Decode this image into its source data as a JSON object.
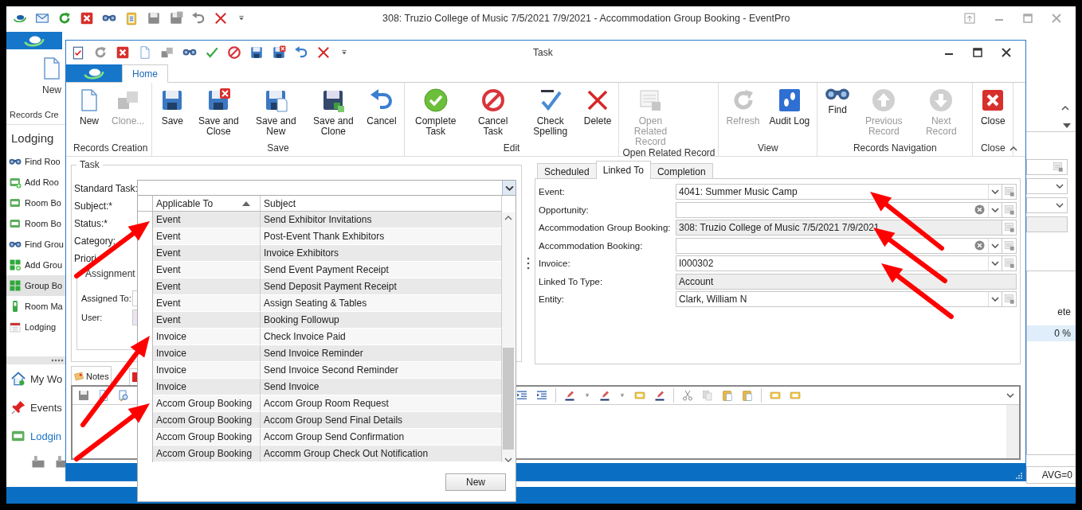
{
  "main_window": {
    "title": "308: Truzio College of Music 7/5/2021 7/9/2021 - Accommodation Group Booking - EventPro",
    "ribbon": {
      "new_button": "New",
      "group_label": "Records Cre"
    },
    "navigation": {
      "heading": "Lodging",
      "items": [
        {
          "label": "Find Roo",
          "selected": false
        },
        {
          "label": "Add Roo",
          "selected": false
        },
        {
          "label": "Room Bo",
          "selected": false
        },
        {
          "label": "Room Bo",
          "selected": false
        },
        {
          "label": "Find Grou",
          "selected": false
        },
        {
          "label": "Add Grou",
          "selected": false
        },
        {
          "label": "Group Bo",
          "selected": true
        },
        {
          "label": "Room Ma",
          "selected": false
        },
        {
          "label": "Lodging",
          "selected": false
        }
      ]
    },
    "nav_bar": [
      {
        "label": "My Wo",
        "selected": false
      },
      {
        "label": "Events",
        "selected": false
      },
      {
        "label": "Lodgin",
        "selected": true
      }
    ],
    "side_content": {
      "column_label": "ete",
      "percent": "0 %",
      "summary": "AVG=0"
    }
  },
  "task_window": {
    "title": "Task",
    "tabs": [
      {
        "label": "Home",
        "selected": true
      }
    ],
    "ribbon_groups": [
      {
        "label": "Records Creation",
        "buttons": [
          {
            "label": "New",
            "disabled": false
          },
          {
            "label": "Clone...",
            "disabled": true
          }
        ]
      },
      {
        "label": "Save",
        "buttons": [
          {
            "label": "Save",
            "disabled": false
          },
          {
            "label": "Save and Close",
            "disabled": false
          },
          {
            "label": "Save and New",
            "disabled": false
          },
          {
            "label": "Save and Clone",
            "disabled": false
          },
          {
            "label": "Cancel",
            "disabled": false
          }
        ]
      },
      {
        "label": "Edit",
        "buttons": [
          {
            "label": "Complete Task",
            "disabled": false
          },
          {
            "label": "Cancel Task",
            "disabled": false
          },
          {
            "label": "Check Spelling",
            "disabled": false
          },
          {
            "label": "Delete",
            "disabled": false
          }
        ]
      },
      {
        "label": "Open Related Record",
        "buttons": [
          {
            "label": "Open Related Record",
            "disabled": true
          }
        ]
      },
      {
        "label": "View",
        "buttons": [
          {
            "label": "Refresh",
            "disabled": true
          },
          {
            "label": "Audit Log",
            "disabled": false
          }
        ]
      },
      {
        "label": "Records Navigation",
        "buttons": [
          {
            "label": "Find",
            "disabled": false
          },
          {
            "label": "Previous Record",
            "disabled": true
          },
          {
            "label": "Next Record",
            "disabled": true
          }
        ]
      },
      {
        "label": "Close",
        "buttons": [
          {
            "label": "Close",
            "disabled": false
          }
        ]
      }
    ],
    "task_form": {
      "legend": "Task",
      "labels": [
        "Standard Task:",
        "Subject:*",
        "Status:*",
        "Category:",
        "Priori"
      ],
      "assignment": {
        "legend": "Assignment",
        "labels": [
          "Assigned To:",
          "User:"
        ]
      }
    },
    "notes_tabs": [
      {
        "label": "Notes",
        "selected": true
      }
    ],
    "linked_tabs": [
      {
        "label": "Scheduled",
        "selected": false
      },
      {
        "label": "Linked To",
        "selected": true
      },
      {
        "label": "Completion",
        "selected": false
      }
    ],
    "linked_fields": [
      {
        "label": "Event:",
        "value": "4041: Summer Music Camp",
        "kind": "combo",
        "clearable": false
      },
      {
        "label": "Opportunity:",
        "kind": "combo",
        "clearable": true
      },
      {
        "label": "Accommodation Group Booking:",
        "value": "308: Truzio College of Music 7/5/2021 7/9/2021",
        "kind": "lookup",
        "clearable": false
      },
      {
        "label": "Accommodation Booking:",
        "kind": "combo",
        "clearable": true
      },
      {
        "label": "Invoice:",
        "value": "I000302",
        "kind": "combo",
        "clearable": false
      },
      {
        "label": "Linked To Type:",
        "value": "Account",
        "kind": "readonly",
        "clearable": false
      },
      {
        "label": "Entity:",
        "value": "Clark, William N",
        "kind": "combo",
        "clearable": false
      }
    ]
  },
  "standard_task_dropdown": {
    "columns": [
      "Applicable To",
      "Subject"
    ],
    "new_button": "New",
    "rows": [
      {
        "applicable_to": "Event",
        "subject": "Send Exhibitor Invitations"
      },
      {
        "applicable_to": "Event",
        "subject": "Post-Event Thank Exhibitors"
      },
      {
        "applicable_to": "Event",
        "subject": "Invoice Exhibitors"
      },
      {
        "applicable_to": "Event",
        "subject": "Send Event Payment Receipt"
      },
      {
        "applicable_to": "Event",
        "subject": "Send Deposit Payment Receipt"
      },
      {
        "applicable_to": "Event",
        "subject": "Assign Seating & Tables"
      },
      {
        "applicable_to": "Event",
        "subject": "Booking Followup"
      },
      {
        "applicable_to": "Invoice",
        "subject": "Check Invoice Paid"
      },
      {
        "applicable_to": "Invoice",
        "subject": "Send Invoice Reminder"
      },
      {
        "applicable_to": "Invoice",
        "subject": "Send Invoice Second Reminder"
      },
      {
        "applicable_to": "Invoice",
        "subject": "Send Invoice"
      },
      {
        "applicable_to": "Accom Group Booking",
        "subject": "Accom Group Room Request"
      },
      {
        "applicable_to": "Accom Group Booking",
        "subject": "Accom Group Send Final Details"
      },
      {
        "applicable_to": "Accom Group Booking",
        "subject": "Accom Group Send Confirmation"
      },
      {
        "applicable_to": "Accom Group Booking",
        "subject": "Accomm Group Check Out Notification"
      }
    ]
  }
}
